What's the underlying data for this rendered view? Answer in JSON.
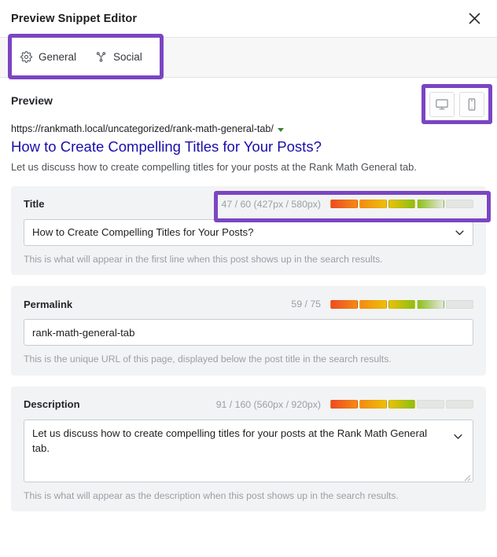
{
  "header": {
    "title": "Preview Snippet Editor",
    "close_icon": "close-icon"
  },
  "tabs": [
    {
      "label": "General",
      "icon": "gear-icon",
      "active": true
    },
    {
      "label": "Social",
      "icon": "share-nodes-icon",
      "active": false
    }
  ],
  "preview": {
    "label": "Preview",
    "devices": [
      {
        "name": "desktop",
        "icon": "desktop-monitor-icon",
        "active": true
      },
      {
        "name": "mobile",
        "icon": "mobile-phone-icon",
        "active": false
      }
    ],
    "snippet": {
      "url": "https://rankmath.local/uncategorized/rank-math-general-tab/",
      "url_caret_icon": "caret-down-icon",
      "title": "How to Create Compelling Titles for Your Posts?",
      "description": "Let us discuss how to create compelling titles for your posts at the Rank Math General tab."
    }
  },
  "fields": {
    "title": {
      "label": "Title",
      "counter": "47 / 60 (427px / 580px)",
      "value": "How to Create Compelling Titles for Your Posts?",
      "help": "This is what will appear in the first line when this post shows up in the search results.",
      "segments_filled": 4,
      "segments_total": 5
    },
    "permalink": {
      "label": "Permalink",
      "counter": "59 / 75",
      "value": "rank-math-general-tab",
      "help": "This is the unique URL of this page, displayed below the post title in the search results.",
      "segments_filled": 4,
      "segments_total": 5
    },
    "description": {
      "label": "Description",
      "counter": "91 / 160 (560px / 920px)",
      "value": "Let us discuss how to create compelling titles for your posts at the Rank Math General tab.",
      "help": "This is what will appear as the description when this post shows up in the search results.",
      "segments_filled": 3,
      "segments_total": 5
    }
  },
  "colors": {
    "highlight_purple": "#7b45c3",
    "serp_link_blue": "#1a0dab",
    "serp_url_green": "#3c8039",
    "panel_gray": "#f2f3f4",
    "segment_colors": [
      "#ed4b24",
      "#f58b12",
      "#ebc007",
      "#8cc014",
      "#e4e6e4"
    ],
    "segment_empty": "#e4e6e4"
  }
}
